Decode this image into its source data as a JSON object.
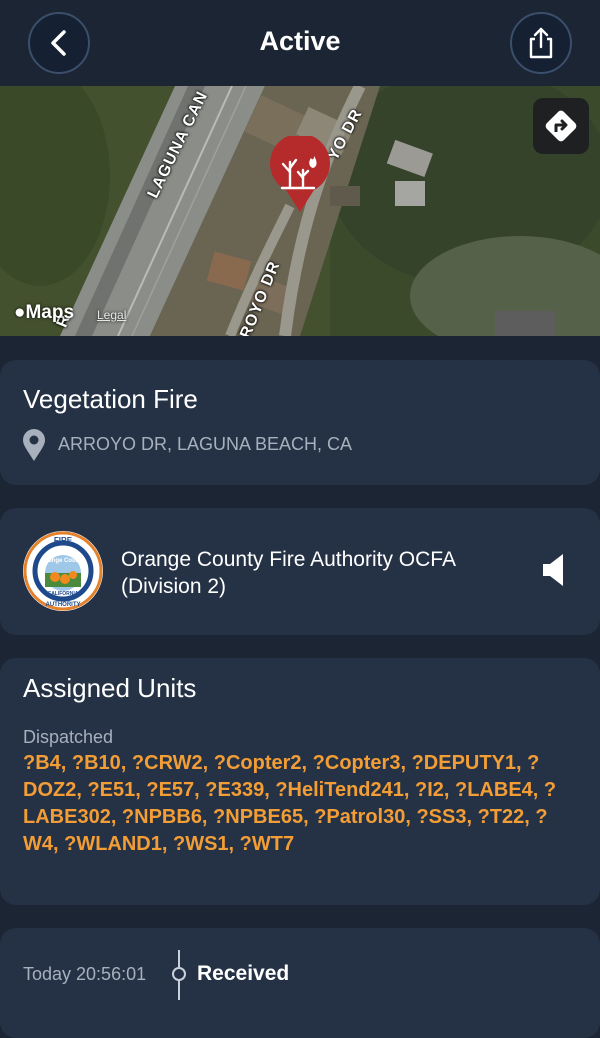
{
  "header": {
    "title": "Active",
    "back_icon": "chevron-left-icon",
    "share_icon": "share-icon"
  },
  "map": {
    "road_labels": [
      "LAGUNA CAN",
      "YO DR",
      "ROYO DR",
      "R"
    ],
    "attribution": "Maps",
    "legal_label": "Legal",
    "directions_icon": "directions-arrow-icon",
    "pin_icon": "vegetation-fire-pin-icon"
  },
  "incident": {
    "type": "Vegetation Fire",
    "address": "ARROYO DR, LAGUNA BEACH, CA",
    "location_icon": "location-pin-icon"
  },
  "agency": {
    "name": "Orange County Fire Authority OCFA (Division 2)",
    "logo_text": [
      "FIRE",
      "Orange County",
      "CALIFORNIA",
      "AUTHORITY"
    ],
    "speaker_icon": "speaker-icon"
  },
  "units": {
    "heading": "Assigned Units",
    "status": "Dispatched",
    "list": "?B4, ?B10, ?CRW2, ?Copter2, ?Copter3, ?DEPUTY1, ?DOZ2, ?E51, ?E57, ?E339, ?HeliTend241, ?I2, ?LABE4, ?LABE302, ?NPBB6, ?NPBE65, ?Patrol30, ?SS3, ?T22, ?W4, ?WLAND1, ?WS1, ?WT7"
  },
  "timeline": {
    "time": "Today 20:56:01",
    "label": "Received"
  },
  "colors": {
    "background": "#1b2533",
    "card": "#253245",
    "accent_orange": "#f29d35",
    "pin_red": "#b52a2a",
    "muted_text": "#a7b0bc"
  }
}
